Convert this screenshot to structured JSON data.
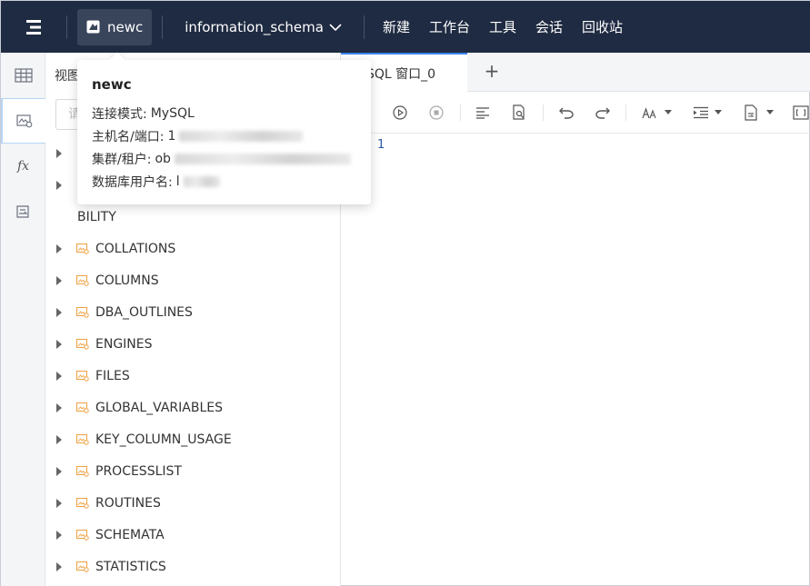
{
  "header": {
    "connection_name": "newc",
    "database": "information_schema",
    "menu": [
      "新建",
      "工作台",
      "工具",
      "会话",
      "回收站"
    ]
  },
  "rail": {
    "items": [
      "table-icon",
      "view-icon",
      "function-icon",
      "procedure-icon"
    ],
    "fx_label": "fx"
  },
  "sidebar": {
    "header_label": "视图",
    "search_placeholder": "请",
    "tree": [
      {
        "label": "",
        "partial": true
      },
      {
        "label": "",
        "partial": true
      },
      {
        "label": "BILITY",
        "partial": true,
        "no_caret": true
      },
      {
        "label": "COLLATIONS"
      },
      {
        "label": "COLUMNS"
      },
      {
        "label": "DBA_OUTLINES"
      },
      {
        "label": "ENGINES"
      },
      {
        "label": "FILES"
      },
      {
        "label": "GLOBAL_VARIABLES"
      },
      {
        "label": "KEY_COLUMN_USAGE"
      },
      {
        "label": "PROCESSLIST"
      },
      {
        "label": "ROUTINES"
      },
      {
        "label": "SCHEMATA"
      },
      {
        "label": "STATISTICS"
      }
    ]
  },
  "editor": {
    "tab_label": "SQL 窗口_0",
    "add_tab": "+",
    "line_number": "1"
  },
  "popover": {
    "title": "newc",
    "mode_label": "连接模式:",
    "mode_value": "MySQL",
    "host_label": "主机名/端口:",
    "host_value": "1",
    "cluster_label": "集群/租户:",
    "cluster_value": "ob",
    "user_label": "数据库用户名:",
    "user_value": "l"
  },
  "colors": {
    "topbar": "#1f2b42",
    "accent": "#3a84f0",
    "tree_icon": "#f0a040"
  }
}
